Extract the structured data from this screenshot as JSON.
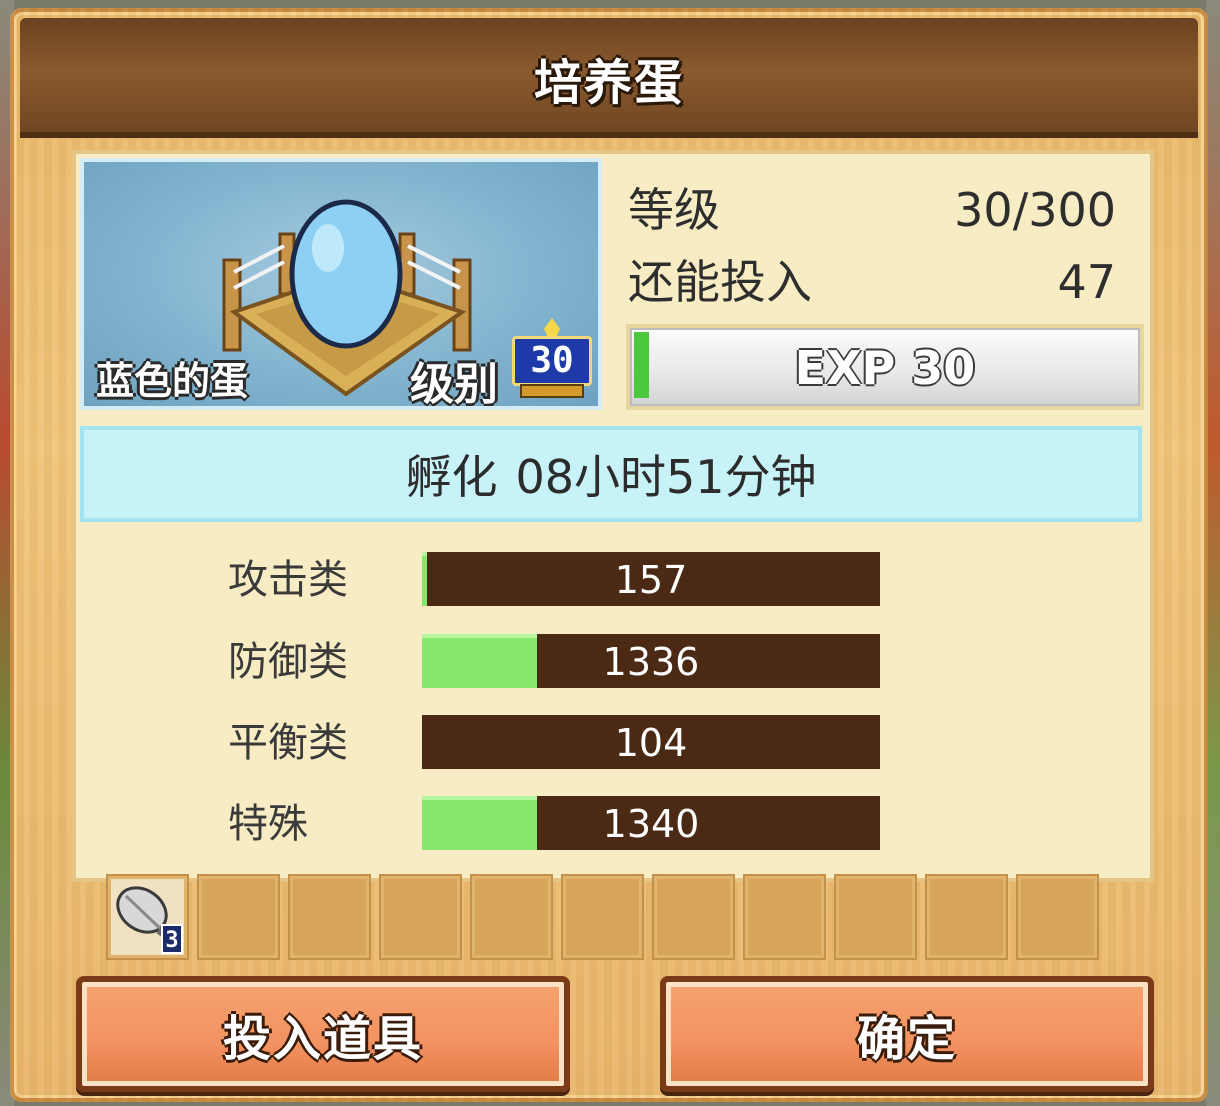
{
  "title": "培养蛋",
  "egg": {
    "name": "蓝色的蛋",
    "rank_label": "级别",
    "rank_value": "30"
  },
  "stats": {
    "level_label": "等级",
    "level_value": "30/300",
    "remaining_label": "还能投入",
    "remaining_value": "47",
    "exp_text": "EXP 30",
    "exp_progress": 0.03
  },
  "hatch": {
    "label": "孵化",
    "time": "08小时51分钟"
  },
  "attributes": [
    {
      "label": "攻击类",
      "value": "157",
      "fill": 0.01
    },
    {
      "label": "防御类",
      "value": "1336",
      "fill": 0.25
    },
    {
      "label": "平衡类",
      "value": "104",
      "fill": 0.0
    },
    {
      "label": "特殊",
      "value": "1340",
      "fill": 0.25
    }
  ],
  "items": {
    "first_item_icon": "feather-icon",
    "first_item_count": "3",
    "empty_slots": 10
  },
  "buttons": {
    "use_item": "投入道具",
    "confirm": "确定"
  },
  "colors": {
    "title_bar": "#7a4c26",
    "panel": "#f8ecc4",
    "hatch_bar": "#c6f2f8",
    "attr_bar": "#4a2a14",
    "attr_fill": "#86e86a",
    "button": "#f29260"
  }
}
